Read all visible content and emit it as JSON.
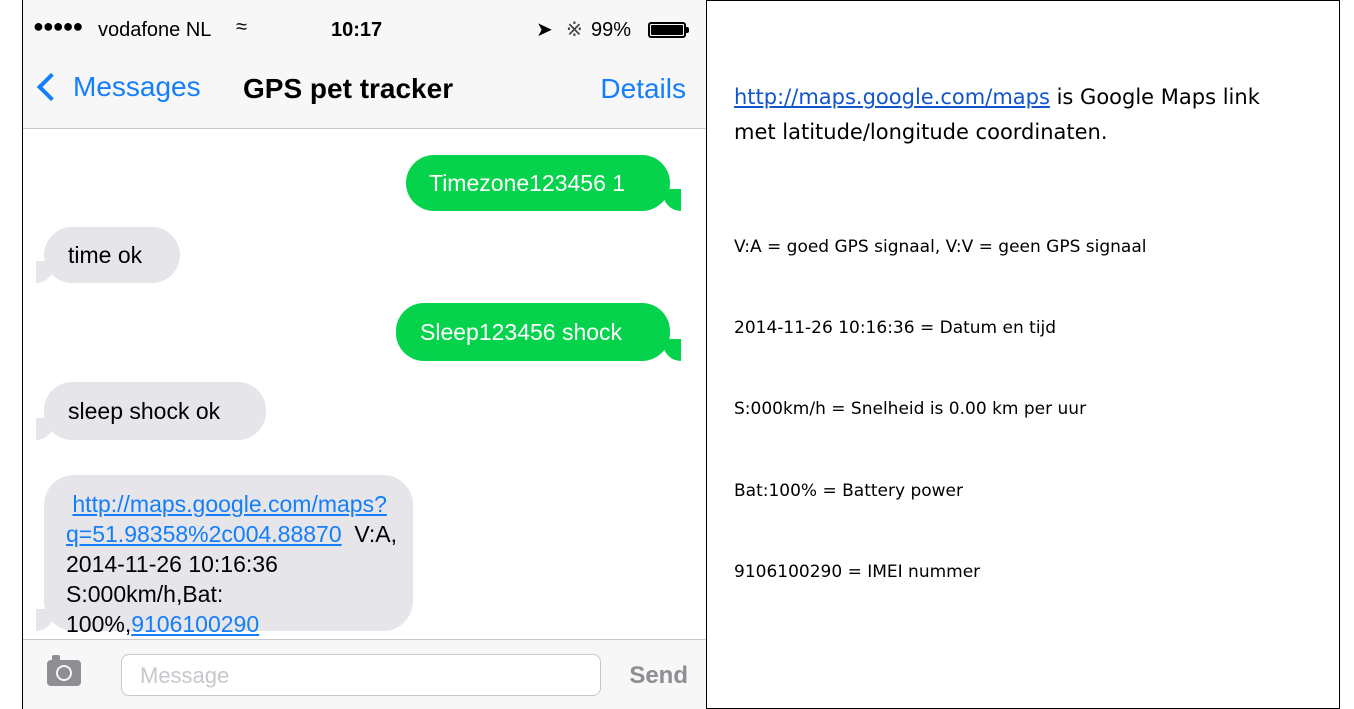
{
  "status_bar": {
    "signal": "●●●●●",
    "carrier": "vodafone NL",
    "time": "10:17",
    "battery_pct": "99%",
    "battery_level": 0.99
  },
  "nav": {
    "back_label": "Messages",
    "title": "GPS pet tracker",
    "details_label": "Details"
  },
  "messages": [
    {
      "dir": "out",
      "text": "Timezone123456 1"
    },
    {
      "dir": "in",
      "text": "time ok"
    },
    {
      "dir": "out",
      "text": "Sleep123456 shock"
    },
    {
      "dir": "in",
      "text": "sleep shock ok"
    },
    {
      "dir": "in",
      "link_line1": "http://maps.google.com/maps?",
      "link_line2": "q=51.98358%2c004.88870",
      "after_link": "  V:A,",
      "line3": "2014-11-26 10:16:36 S:000km/h,Bat:",
      "line4_prefix": "100%,",
      "imei_link": "9106100290"
    }
  ],
  "input_bar": {
    "placeholder": "Message",
    "send_label": "Send"
  },
  "notes": {
    "intro_link": "http://maps.google.com/maps",
    "intro_text_1": " is Google Maps link",
    "intro_text_2": "met latitude/longitude coordinaten.",
    "lines": [
      "V:A = goed GPS signaal, V:V = geen GPS signaal",
      "2014-11-26 10:16:36 = Datum en tijd",
      "S:000km/h = Snelheid is 0.00 km per uur",
      "Bat:100% = Battery power",
      "9106100290 = IMEI nummer"
    ]
  },
  "colors": {
    "ios_blue": "#157efb",
    "sent_bubble": "#06d34c",
    "received_bubble": "#e5e5ea",
    "link_blue": "#1155cc"
  }
}
